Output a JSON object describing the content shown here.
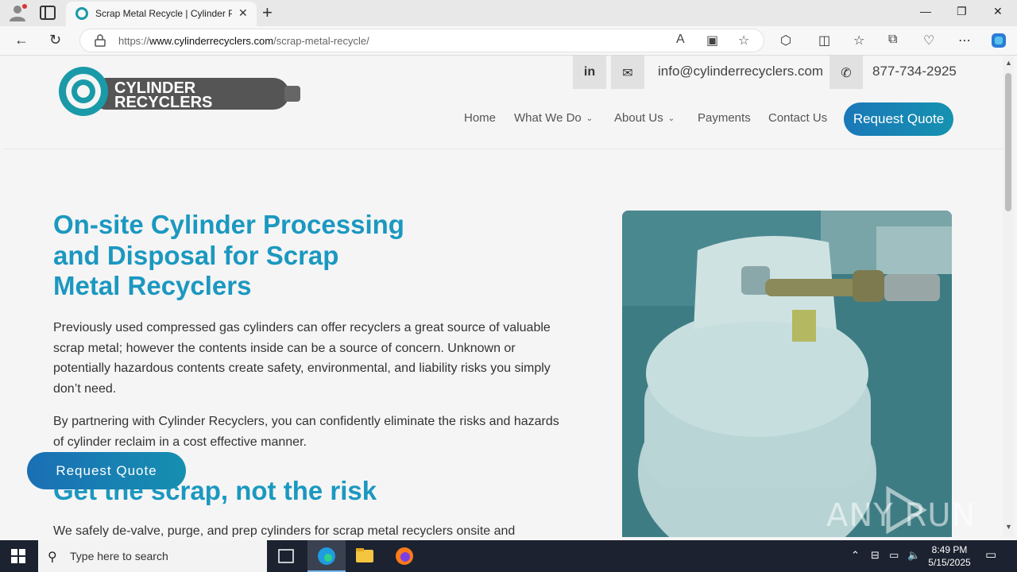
{
  "browser": {
    "tab_title": "Scrap Metal Recycle | Cylinder Pr",
    "url_prefix": "https://",
    "url_domain": "www.cylinderrecyclers.com",
    "url_path": "/scrap-metal-recycle/"
  },
  "site": {
    "logo_line1": "CYLINDER",
    "logo_line2": "RECYCLERS",
    "email": "info@cylinderrecyclers.com",
    "phone": "877-734-2925",
    "nav": [
      "Home",
      "What We Do",
      "About Us",
      "Payments",
      "Contact Us"
    ],
    "cta": "Request Quote",
    "accent_color": "#1b98c0"
  },
  "content": {
    "title_lines": [
      "On-site Cylinder Processing",
      "and Disposal for Scrap",
      "Metal Recyclers"
    ],
    "para1": "Previously used compressed gas cylinders can offer recyclers a great source of valuable scrap metal; however the contents inside can be a source of concern. Unknown or potentially hazardous contents create safety, environmental, and liability risks you simply don’t need.",
    "para2": "By partnering with Cylinder Recyclers, you can confidently eliminate the risks and hazards of cylinder reclaim in a cost effective manner.",
    "subtitle": "Get the scrap, not the risk",
    "para3_partial": "We safely de-valve, purge, and prep cylinders for scrap metal recyclers onsite and",
    "floating_cta": "Request Quote"
  },
  "watermark": "ANY RUN",
  "taskbar": {
    "search_placeholder": "Type here to search",
    "time": "8:49 PM",
    "date": "5/15/2025"
  }
}
